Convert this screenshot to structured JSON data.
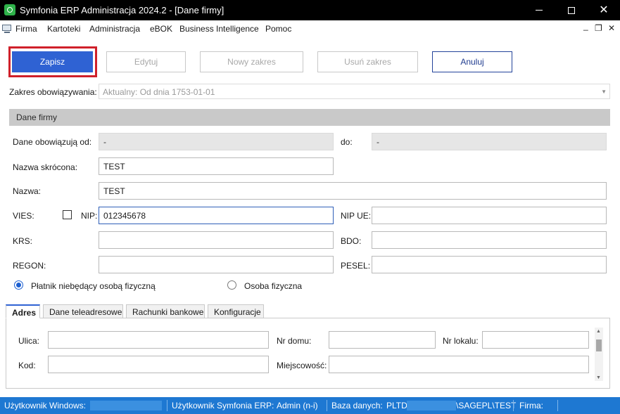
{
  "window": {
    "title": "Symfonia ERP Administracja 2024.2 - [Dane firmy]",
    "min_glyph": "—",
    "close_glyph": "✕"
  },
  "menu": {
    "items": [
      "Firma",
      "Kartoteki",
      "Administracja",
      "eBOK",
      "Business Intelligence",
      "Pomoc"
    ],
    "mdi_min": "_",
    "mdi_restore": "❐",
    "mdi_close": "✕"
  },
  "toolbar": {
    "save": "Zapisz",
    "edit": "Edytuj",
    "new_range": "Nowy zakres",
    "delete_range": "Usuń zakres",
    "cancel": "Anuluj"
  },
  "range": {
    "label": "Zakres obowiązywania:",
    "value": "Aktualny: Od dnia 1753-01-01",
    "arrow": "▼"
  },
  "section": {
    "title": "Dane firmy"
  },
  "form": {
    "valid_from_label": "Dane obowiązują od:",
    "valid_from_value": "-",
    "valid_to_label": "do:",
    "valid_to_value": "-",
    "short_name_label": "Nazwa skrócona:",
    "short_name_value": "TEST",
    "name_label": "Nazwa:",
    "name_value": "TEST",
    "vies_label": "VIES:",
    "nip_label": "NIP:",
    "nip_value": "012345678",
    "nip_ue_label": "NIP UE:",
    "nip_ue_value": "",
    "krs_label": "KRS:",
    "krs_value": "",
    "bdo_label": "BDO:",
    "bdo_value": "",
    "regon_label": "REGON:",
    "regon_value": "",
    "pesel_label": "PESEL:",
    "pesel_value": "",
    "radio_legal": "Płatnik niebędący osobą fizyczną",
    "radio_person": "Osoba fizyczna",
    "radio_selected": "legal"
  },
  "tabs": [
    {
      "label": "Adres",
      "active": true
    },
    {
      "label": "Dane teleadresowe",
      "active": false
    },
    {
      "label": "Rachunki bankowe",
      "active": false
    },
    {
      "label": "Konfiguracje",
      "active": false
    }
  ],
  "address": {
    "street_label": "Ulica:",
    "street_value": "",
    "house_label": "Nr domu:",
    "house_value": "",
    "flat_label": "Nr lokalu:",
    "flat_value": "",
    "postcode_label": "Kod:",
    "postcode_value": "",
    "city_label": "Miejscowość:",
    "city_value": ""
  },
  "statusbar": {
    "windows_user_label": "Użytkownik Windows:",
    "erp_user_label": "Użytkownik Symfonia ERP:",
    "erp_user_value": "Admin (n-i)",
    "db_label": "Baza danych:",
    "db_prefix": "PLTD",
    "db_suffix": "\\SAGEPL\\TEST",
    "company_label": "Firma:"
  },
  "colors": {
    "accent": "#2f62d3",
    "highlight": "#d0202a",
    "statusbar": "#1e78d2",
    "section_header": "#c9c9c9"
  },
  "icons": [
    "app-icon",
    "window-menu-icon",
    "minimize-icon",
    "maximize-icon",
    "close-icon",
    "dropdown-arrow-icon"
  ]
}
